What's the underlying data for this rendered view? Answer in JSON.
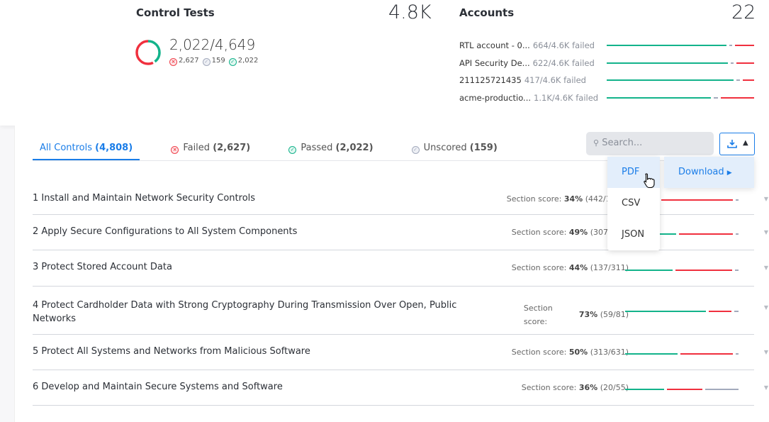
{
  "control_tests": {
    "title": "Control Tests",
    "total": "4.8K",
    "ratio": "2,022/4,649",
    "failed": "2,627",
    "unscored": "159",
    "passed": "2,022"
  },
  "accounts": {
    "title": "Accounts",
    "total": "22",
    "items": [
      {
        "name": "RTL account - 0...",
        "stat": "664/4.6K failed",
        "bar": [
          0.82,
          0.02,
          0.13
        ]
      },
      {
        "name": "API Security De...",
        "stat": "622/4.6K failed",
        "bar": [
          0.83,
          0.02,
          0.12
        ]
      },
      {
        "name": "211125721435",
        "stat": "417/4.6K failed",
        "bar": [
          0.87,
          0.02,
          0.08
        ]
      },
      {
        "name": "acme-productio...",
        "stat": "1.1K/4.6K failed",
        "bar": [
          0.72,
          0.03,
          0.23
        ]
      }
    ]
  },
  "tabs": [
    {
      "label": "All Controls",
      "count": "(4,808)",
      "icon": ""
    },
    {
      "label": "Failed",
      "count": "(2,627)",
      "icon": "failed"
    },
    {
      "label": "Passed",
      "count": "(2,022)",
      "icon": "passed"
    },
    {
      "label": "Unscored",
      "count": "(159)",
      "icon": "unscored"
    }
  ],
  "search": {
    "placeholder": "Search..."
  },
  "download_menu": {
    "items": [
      "PDF",
      "CSV",
      "JSON"
    ],
    "submenu": "Download"
  },
  "sections": [
    {
      "title": "1 Install and Maintain Network Security Controls",
      "label": "Section score:",
      "pct": "34%",
      "frac": "(442/1319)",
      "bar": [
        0.3,
        0.65,
        0.02
      ]
    },
    {
      "title": "2 Apply Secure Configurations to All System Components",
      "label": "Section score:",
      "pct": "49%",
      "frac": "(307/623)",
      "bar": [
        0.45,
        0.48,
        0.02
      ]
    },
    {
      "title": "3 Protect Stored Account Data",
      "label": "Section score:",
      "pct": "44%",
      "frac": "(137/311)",
      "bar": [
        0.42,
        0.5,
        0.03
      ]
    },
    {
      "title": "4 Protect Cardholder Data with Strong Cryptography During Transmission Over Open, Public Networks",
      "label": "Section score:",
      "pct": "73%",
      "frac": "(59/81)",
      "bar": [
        0.72,
        0.2,
        0.04
      ]
    },
    {
      "title": "5 Protect All Systems and Networks from Malicious Software",
      "label": "Section score:",
      "pct": "50%",
      "frac": "(313/631)",
      "bar": [
        0.48,
        0.48,
        0.01
      ]
    },
    {
      "title": "6 Develop and Maintain Secure Systems and Software",
      "label": "Section score:",
      "pct": "36%",
      "frac": "(20/55)",
      "bar": [
        0.35,
        0.32,
        0.3
      ]
    }
  ],
  "colors": {
    "passed": "#13b38b",
    "failed": "#f0303e",
    "unscored": "#a3aabc",
    "accent": "#1a7de8"
  }
}
